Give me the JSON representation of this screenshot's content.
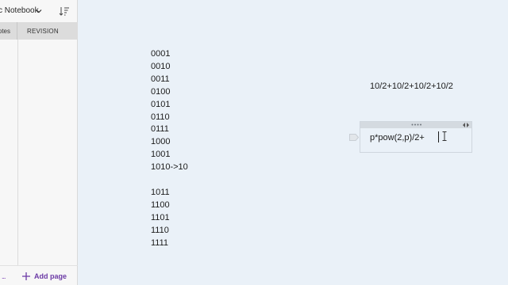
{
  "nav": {
    "notebook_title": "c Notebook",
    "tabs": [
      {
        "label": "otes"
      },
      {
        "label": "REVISION"
      }
    ],
    "footer_dots": "...",
    "add_page_label": "Add page",
    "icons": {
      "notebook_dropdown": "chevron-down-icon",
      "sort": "sort-icon",
      "add": "plus-icon"
    },
    "colors": {
      "accent": "#6b3aa5",
      "tab_strip": "#dcdcdc",
      "panel": "#f7f7f7"
    }
  },
  "page": {
    "binary_group_1": [
      "0001",
      "0010",
      "0011",
      "0100",
      "0101",
      "0110",
      "0111",
      "1000",
      "1001",
      "1010->10"
    ],
    "binary_group_2": [
      "1011",
      "1100",
      "1101",
      "1110",
      "1111"
    ],
    "expression": "10/2+10/2+10/2+10/2",
    "note": {
      "text": "p*pow(2,p)/2+"
    },
    "colors": {
      "canvas": "#eaf1f8",
      "text": "#1b1b1b"
    }
  }
}
